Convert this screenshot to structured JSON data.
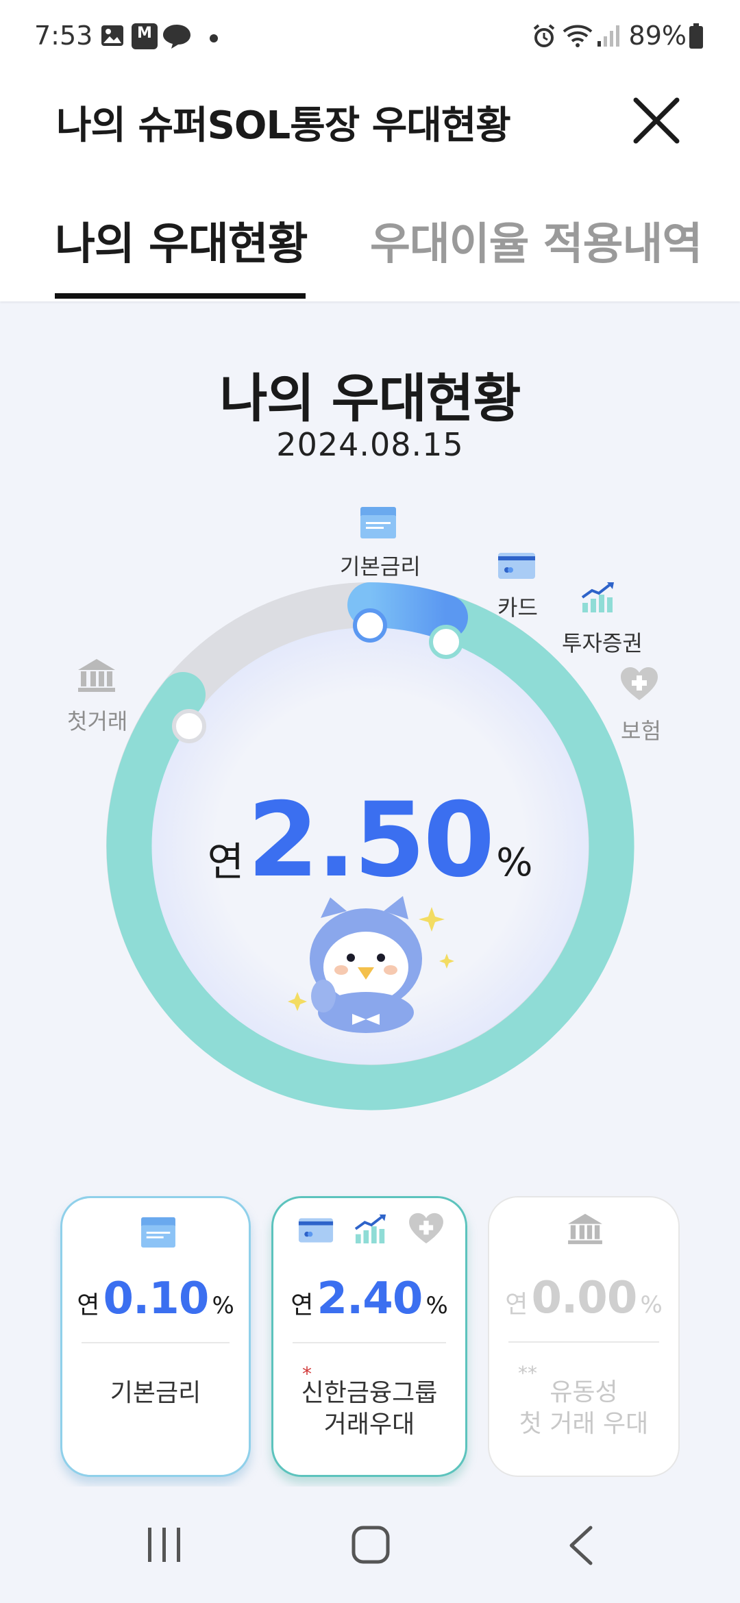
{
  "status_bar": {
    "time": "7:53",
    "battery": "89%",
    "stock_badge": "M"
  },
  "header": {
    "title": "나의 슈퍼SOL통장 우대현황",
    "tabs": [
      {
        "label": "나의 우대현황",
        "active": true
      },
      {
        "label": "우대이율 적용내역",
        "active": false
      }
    ]
  },
  "summary": {
    "title": "나의 우대현황",
    "date": "2024.08.15",
    "rate_prefix": "연",
    "rate_value": "2.50",
    "rate_unit": "%"
  },
  "ring_labels": {
    "base": "기본금리",
    "card": "카드",
    "investment": "투자증권",
    "insurance": "보험",
    "first_trade": "첫거래"
  },
  "cards": [
    {
      "prefix": "연",
      "value": "0.10",
      "unit": "%",
      "label": "기본금리",
      "icons": [
        "base-rate-icon"
      ]
    },
    {
      "prefix": "연",
      "value": "2.40",
      "unit": "%",
      "mark": "*",
      "label_line1": "신한금융그룹",
      "label_line2": "거래우대",
      "icons": [
        "card-icon",
        "investment-chart-icon",
        "insurance-heart-icon"
      ]
    },
    {
      "prefix": "연",
      "value": "0.00",
      "unit": "%",
      "mark": "**",
      "label_line1": "유동성",
      "label_line2": "첫 거래 우대",
      "icons": [
        "bank-icon"
      ]
    }
  ],
  "colors": {
    "accent_blue": "#3b6ff0",
    "teal": "#8fdcd6",
    "light_blue": "#8fd0ea"
  }
}
